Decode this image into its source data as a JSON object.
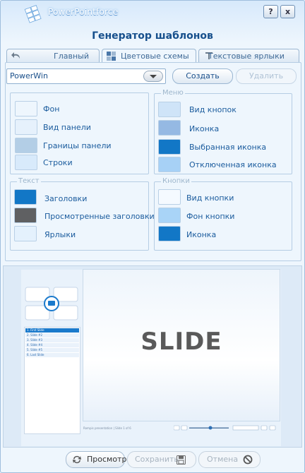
{
  "app": {
    "brand": "PowerPointforce",
    "title": "Генератор шаблонов",
    "help_label": "?",
    "close_label": "x"
  },
  "tabs": [
    {
      "label": "Главный",
      "icon": "back-arrow-icon"
    },
    {
      "label": "Цветовые схемы",
      "icon": "palette-grid-icon"
    },
    {
      "label": "Текстовые ярлыки",
      "icon": "text-icon"
    }
  ],
  "scheme": {
    "selected": "PowerWin",
    "create_label": "Создать",
    "delete_label": "Удалить"
  },
  "groups": {
    "general": {
      "items": [
        {
          "label": "Фон",
          "color": "#eef6fd"
        },
        {
          "label": "Вид панели",
          "color": "#e6f1fc"
        },
        {
          "label": "Границы панели",
          "color": "#b3cee6"
        },
        {
          "label": "Строки",
          "color": "#d8eafb"
        }
      ]
    },
    "menu": {
      "legend": "Меню",
      "items": [
        {
          "label": "Вид кнопок",
          "color": "#cfe4f8"
        },
        {
          "label": "Иконка",
          "color": "#95b9e3"
        },
        {
          "label": "Выбранная иконка",
          "color": "#1277c6"
        },
        {
          "label": "Отключенная иконка",
          "color": "#a7d1f6"
        }
      ]
    },
    "text": {
      "legend": "Текст",
      "items": [
        {
          "label": "Заголовки",
          "color": "#1277c6"
        },
        {
          "label": "Просмотренные заголовки",
          "color": "#5f6062"
        },
        {
          "label": "Ярлыки",
          "color": "#e4f1fd"
        }
      ]
    },
    "buttons": {
      "legend": "Кнопки",
      "items": [
        {
          "label": "Вид кнопки",
          "color": "#f5faff"
        },
        {
          "label": "Фон кнопки",
          "color": "#a9d4f7"
        },
        {
          "label": "Иконка",
          "color": "#1277c6"
        }
      ]
    }
  },
  "preview": {
    "slide_text": "SLIDE",
    "list_items": [
      "1. First Slide",
      "2. Slide #2",
      "3. Slide #3",
      "4. Slide #4",
      "5. Slide #5",
      "6. Last Slide"
    ],
    "footer": "Rompis presentation | Slide 1 of 6"
  },
  "footer": {
    "preview_label": "Просмотр",
    "save_label": "Сохранить",
    "cancel_label": "Отмена"
  }
}
